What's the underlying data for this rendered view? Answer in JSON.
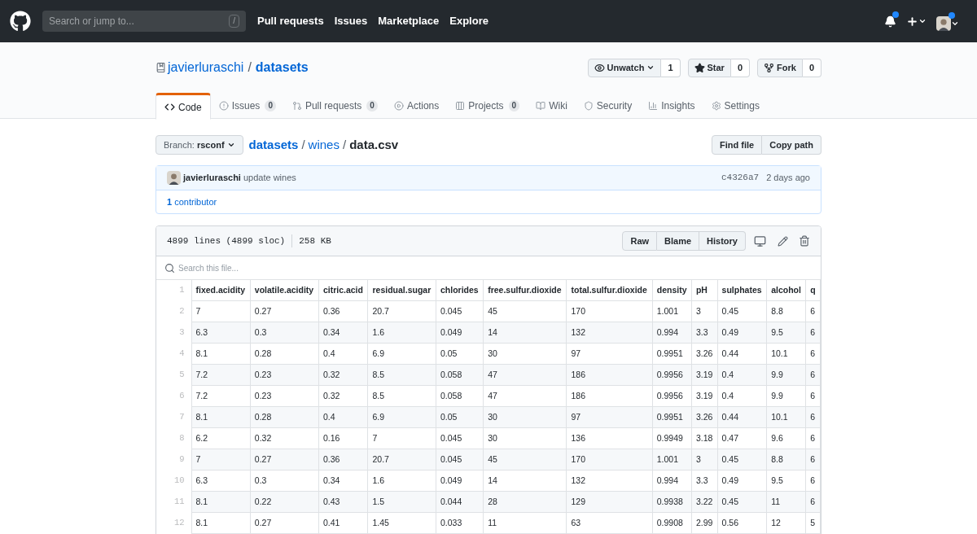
{
  "header": {
    "search_placeholder": "Search or jump to...",
    "search_key": "/",
    "nav": [
      "Pull requests",
      "Issues",
      "Marketplace",
      "Explore"
    ],
    "notifications_unread": true,
    "avatar_badge": true
  },
  "repo": {
    "owner": "javierluraschi",
    "separator": "/",
    "name": "datasets",
    "actions": [
      {
        "label": "Unwatch",
        "count": "1",
        "kind": "watch"
      },
      {
        "label": "Star",
        "count": "0",
        "kind": "star"
      },
      {
        "label": "Fork",
        "count": "0",
        "kind": "fork"
      }
    ]
  },
  "tabs": [
    {
      "label": "Code",
      "kind": "code",
      "selected": true
    },
    {
      "label": "Issues",
      "count": "0",
      "kind": "issues",
      "selected": false
    },
    {
      "label": "Pull requests",
      "count": "0",
      "kind": "pulls",
      "selected": false
    },
    {
      "label": "Actions",
      "kind": "actions",
      "selected": false
    },
    {
      "label": "Projects",
      "count": "0",
      "kind": "projects",
      "selected": false
    },
    {
      "label": "Wiki",
      "kind": "wiki",
      "selected": false
    },
    {
      "label": "Security",
      "kind": "security",
      "selected": false
    },
    {
      "label": "Insights",
      "kind": "insights",
      "selected": false
    },
    {
      "label": "Settings",
      "kind": "settings",
      "selected": false
    }
  ],
  "branch": {
    "label": "Branch:",
    "value": "rsconf"
  },
  "breadcrumb": {
    "links": [
      "datasets",
      "wines"
    ],
    "separator": "/",
    "file": "data.csv"
  },
  "file_buttons": [
    "Find file",
    "Copy path"
  ],
  "commit": {
    "author": "javierluraschi",
    "message": "update wines",
    "sha": "c4326a7",
    "time": "2 days ago"
  },
  "contributors": {
    "count": "1",
    "label": "contributor"
  },
  "file": {
    "lines": "4899 lines (4899 sloc)",
    "size": "258 KB",
    "buttons": [
      "Raw",
      "Blame",
      "History"
    ],
    "search_placeholder": "Search this file..."
  },
  "table": {
    "columns": [
      "fixed.acidity",
      "volatile.acidity",
      "citric.acid",
      "residual.sugar",
      "chlorides",
      "free.sulfur.dioxide",
      "total.sulfur.dioxide",
      "density",
      "pH",
      "sulphates",
      "alcohol",
      "q"
    ],
    "header_line": "1",
    "rows": [
      {
        "line": "2",
        "cells": [
          "7",
          "0.27",
          "0.36",
          "20.7",
          "0.045",
          "45",
          "170",
          "1.001",
          "3",
          "0.45",
          "8.8",
          "6"
        ]
      },
      {
        "line": "3",
        "cells": [
          "6.3",
          "0.3",
          "0.34",
          "1.6",
          "0.049",
          "14",
          "132",
          "0.994",
          "3.3",
          "0.49",
          "9.5",
          "6"
        ]
      },
      {
        "line": "4",
        "cells": [
          "8.1",
          "0.28",
          "0.4",
          "6.9",
          "0.05",
          "30",
          "97",
          "0.9951",
          "3.26",
          "0.44",
          "10.1",
          "6"
        ]
      },
      {
        "line": "5",
        "cells": [
          "7.2",
          "0.23",
          "0.32",
          "8.5",
          "0.058",
          "47",
          "186",
          "0.9956",
          "3.19",
          "0.4",
          "9.9",
          "6"
        ]
      },
      {
        "line": "6",
        "cells": [
          "7.2",
          "0.23",
          "0.32",
          "8.5",
          "0.058",
          "47",
          "186",
          "0.9956",
          "3.19",
          "0.4",
          "9.9",
          "6"
        ]
      },
      {
        "line": "7",
        "cells": [
          "8.1",
          "0.28",
          "0.4",
          "6.9",
          "0.05",
          "30",
          "97",
          "0.9951",
          "3.26",
          "0.44",
          "10.1",
          "6"
        ]
      },
      {
        "line": "8",
        "cells": [
          "6.2",
          "0.32",
          "0.16",
          "7",
          "0.045",
          "30",
          "136",
          "0.9949",
          "3.18",
          "0.47",
          "9.6",
          "6"
        ]
      },
      {
        "line": "9",
        "cells": [
          "7",
          "0.27",
          "0.36",
          "20.7",
          "0.045",
          "45",
          "170",
          "1.001",
          "3",
          "0.45",
          "8.8",
          "6"
        ]
      },
      {
        "line": "10",
        "cells": [
          "6.3",
          "0.3",
          "0.34",
          "1.6",
          "0.049",
          "14",
          "132",
          "0.994",
          "3.3",
          "0.49",
          "9.5",
          "6"
        ]
      },
      {
        "line": "11",
        "cells": [
          "8.1",
          "0.22",
          "0.43",
          "1.5",
          "0.044",
          "28",
          "129",
          "0.9938",
          "3.22",
          "0.45",
          "11",
          "6"
        ]
      },
      {
        "line": "12",
        "cells": [
          "8.1",
          "0.27",
          "0.41",
          "1.45",
          "0.033",
          "11",
          "63",
          "0.9908",
          "2.99",
          "0.56",
          "12",
          "5"
        ]
      }
    ]
  }
}
